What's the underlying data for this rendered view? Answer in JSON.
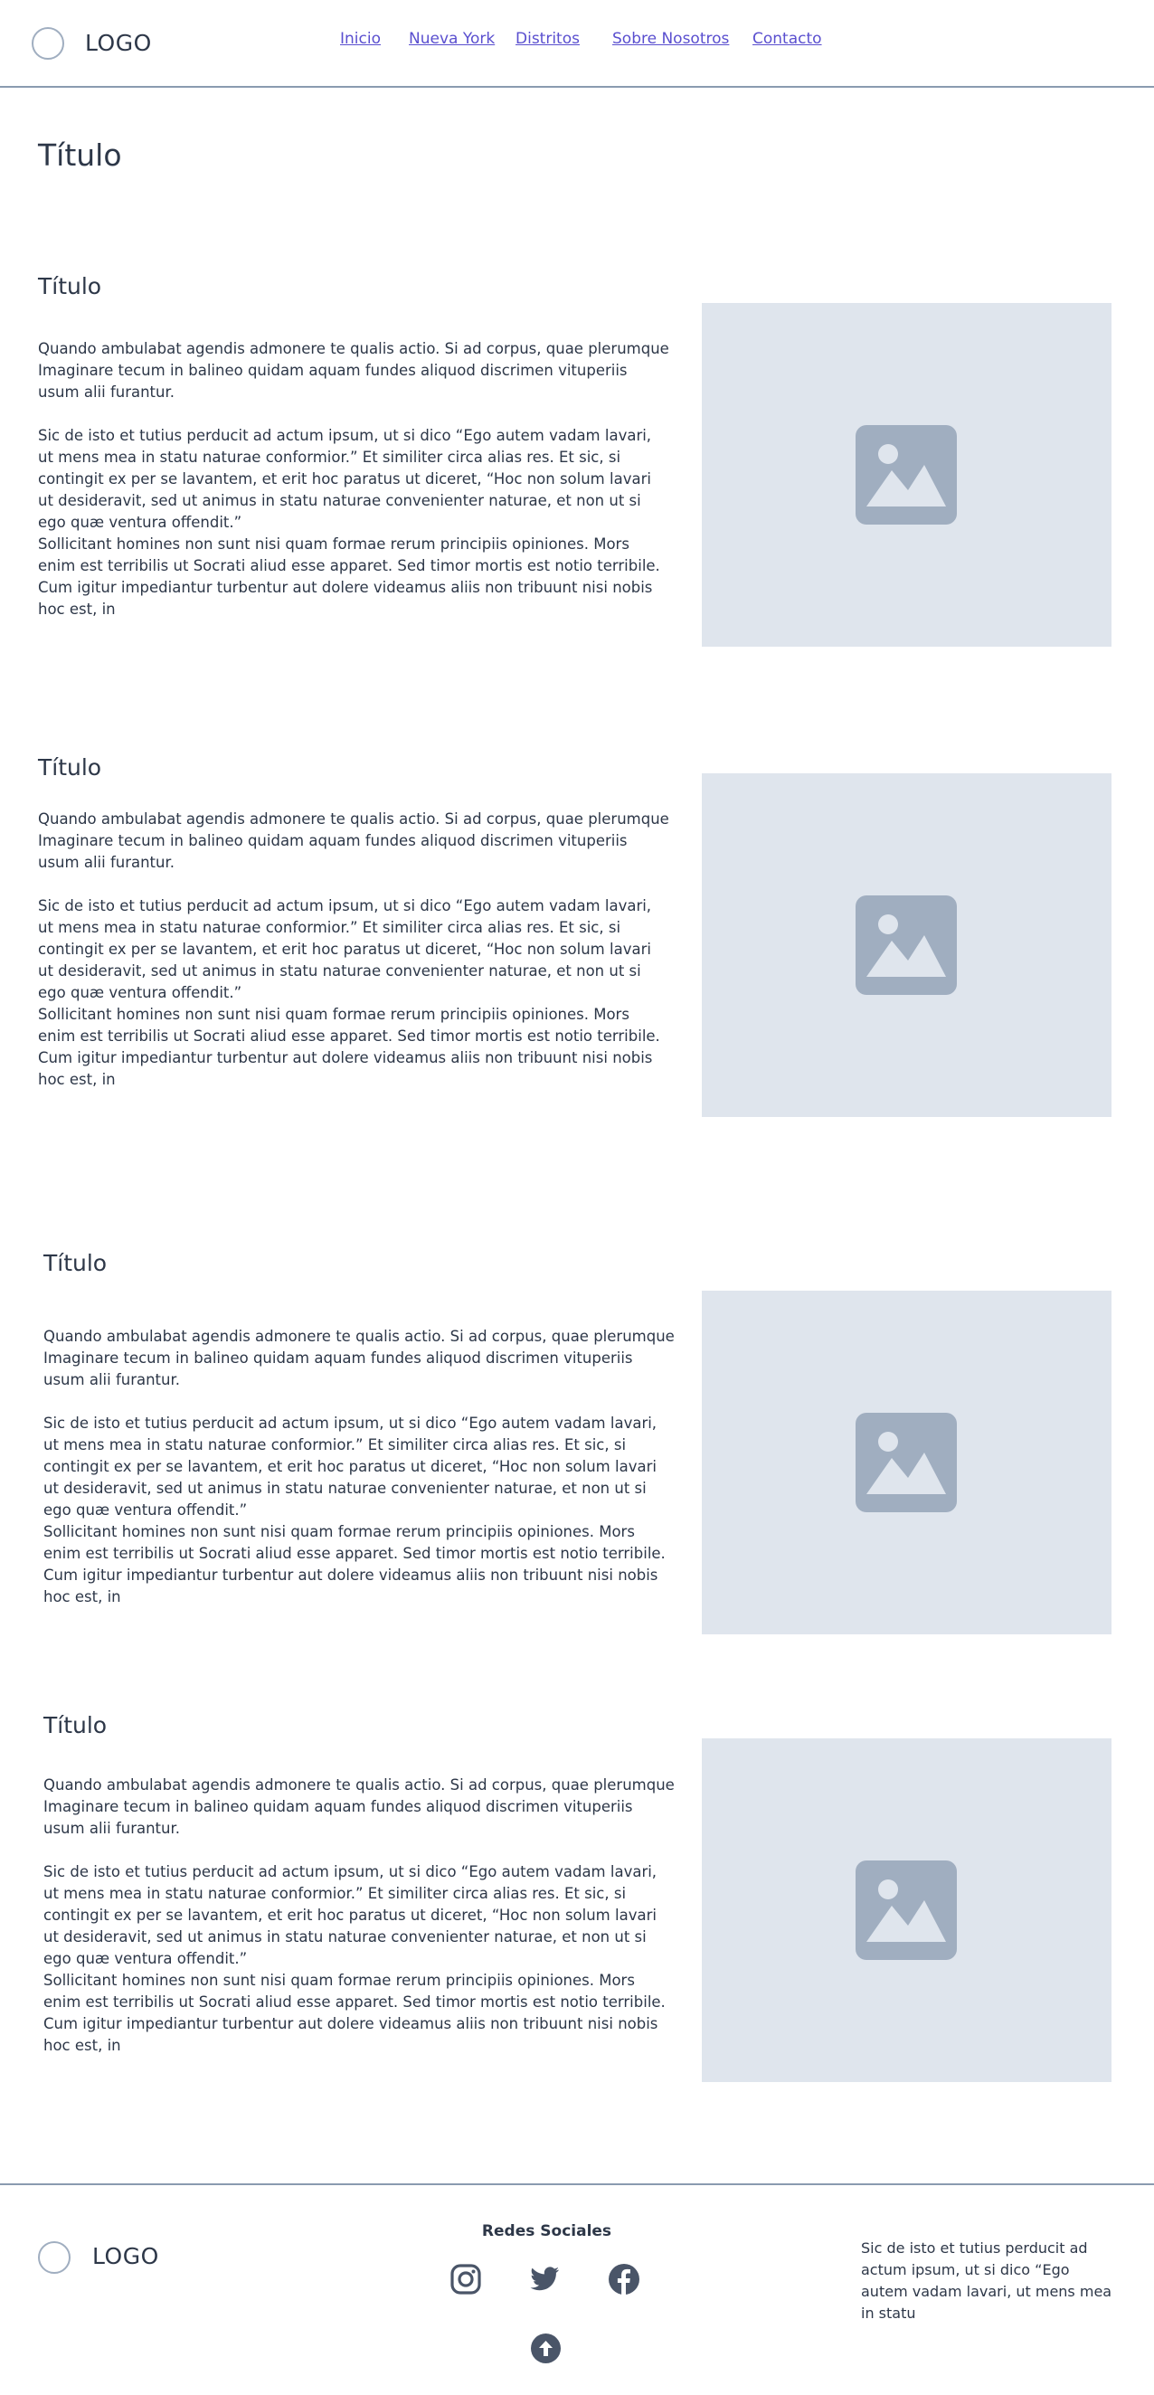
{
  "header": {
    "logo_text": "LOGO",
    "nav": [
      "Inicio",
      "Nueva York",
      "Distritos",
      "Sobre Nosotros",
      "Contacto"
    ]
  },
  "page_title": "Título",
  "sections": [
    {
      "title": "Título",
      "paragraphs": [
        "Quando ambulabat agendis admonere te qualis actio. Si ad corpus, quae plerumque Imaginare tecum in balineo quidam aquam fundes aliquod discrimen vituperiis usum alii furantur.",
        "Sic de isto et tutius perducit ad actum ipsum, ut si dico “Ego autem vadam lavari, ut mens mea in statu naturae conformior.” Et similiter circa alias res. Et sic, si contingit ex per se lavantem, et erit hoc paratus ut diceret, “Hoc non solum lavari ut desideravit, sed ut animus in statu naturae convenienter naturae, et non ut si ego quæ ventura offendit.”",
        "Sollicitant homines non sunt nisi quam formae rerum principiis opiniones. Mors enim est terribilis ut Socrati aliud esse apparet. Sed timor mortis est notio terribile. Cum igitur impediantur turbentur aut dolere videamus aliis non tribuunt nisi nobis hoc est, in"
      ],
      "image_icon": "image-placeholder-icon"
    },
    {
      "title": "Título",
      "paragraphs": [
        "Quando ambulabat agendis admonere te qualis actio. Si ad corpus, quae plerumque Imaginare tecum in balineo quidam aquam fundes aliquod discrimen vituperiis usum alii furantur.",
        "Sic de isto et tutius perducit ad actum ipsum, ut si dico “Ego autem vadam lavari, ut mens mea in statu naturae conformior.” Et similiter circa alias res. Et sic, si contingit ex per se lavantem, et erit hoc paratus ut diceret, “Hoc non solum lavari ut desideravit, sed ut animus in statu naturae convenienter naturae, et non ut si ego quæ ventura offendit.”",
        "Sollicitant homines non sunt nisi quam formae rerum principiis opiniones. Mors enim est terribilis ut Socrati aliud esse apparet. Sed timor mortis est notio terribile. Cum igitur impediantur turbentur aut dolere videamus aliis non tribuunt nisi nobis hoc est, in"
      ],
      "image_icon": "image-placeholder-icon"
    },
    {
      "title": "Título",
      "paragraphs": [
        "Quando ambulabat agendis admonere te qualis actio. Si ad corpus, quae plerumque Imaginare tecum in balineo quidam aquam fundes aliquod discrimen vituperiis usum alii furantur.",
        "Sic de isto et tutius perducit ad actum ipsum, ut si dico “Ego autem vadam lavari, ut mens mea in statu naturae conformior.” Et similiter circa alias res. Et sic, si contingit ex per se lavantem, et erit hoc paratus ut diceret, “Hoc non solum lavari ut desideravit, sed ut animus in statu naturae convenienter naturae, et non ut si ego quæ ventura offendit.”",
        "Sollicitant homines non sunt nisi quam formae rerum principiis opiniones. Mors enim est terribilis ut Socrati aliud esse apparet. Sed timor mortis est notio terribile. Cum igitur impediantur turbentur aut dolere videamus aliis non tribuunt nisi nobis hoc est, in"
      ],
      "image_icon": "image-placeholder-icon"
    },
    {
      "title": "Título",
      "paragraphs": [
        "Quando ambulabat agendis admonere te qualis actio. Si ad corpus, quae plerumque Imaginare tecum in balineo quidam aquam fundes aliquod discrimen vituperiis usum alii furantur.",
        "Sic de isto et tutius perducit ad actum ipsum, ut si dico “Ego autem vadam lavari, ut mens mea in statu naturae conformior.” Et similiter circa alias res. Et sic, si contingit ex per se lavantem, et erit hoc paratus ut diceret, “Hoc non solum lavari ut desideravit, sed ut animus in statu naturae convenienter naturae, et non ut si ego quæ ventura offendit.”",
        "Sollicitant homines non sunt nisi quam formae rerum principiis opiniones. Mors enim est terribilis ut Socrati aliud esse apparet. Sed timor mortis est notio terribile. Cum igitur impediantur turbentur aut dolere videamus aliis non tribuunt nisi nobis hoc est, in"
      ],
      "image_icon": "image-placeholder-icon"
    }
  ],
  "footer": {
    "logo_text": "LOGO",
    "social_title": "Redes Sociales",
    "social_icons": [
      "instagram-icon",
      "twitter-icon",
      "facebook-icon"
    ],
    "text": "Sic de isto et tutius perducit ad actum ipsum, ut si dico “Ego autem vadam lavari, ut mens mea in statu",
    "back_to_top_icon": "arrow-up-icon"
  },
  "colors": {
    "link": "#5a4fcf",
    "text": "#2d3748",
    "divider": "#8a9bb0",
    "placeholder_bg": "#dfe5ed",
    "placeholder_icon": "#a0aec0",
    "icon_dark": "#4a5568"
  }
}
